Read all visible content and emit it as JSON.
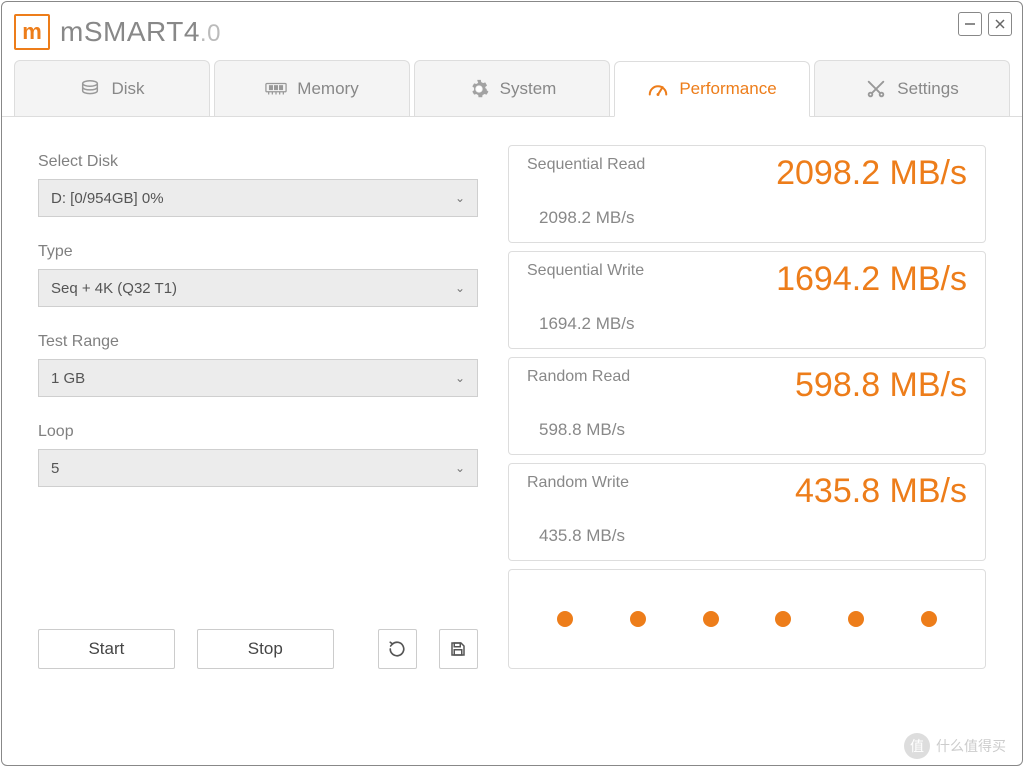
{
  "app": {
    "name": "mSMART",
    "version_major": "4",
    "version_minor": ".0"
  },
  "tabs": {
    "disk": "Disk",
    "memory": "Memory",
    "system": "System",
    "performance": "Performance",
    "settings": "Settings"
  },
  "form": {
    "select_disk_label": "Select Disk",
    "select_disk_value": "D: [0/954GB] 0%",
    "type_label": "Type",
    "type_value": "Seq + 4K (Q32 T1)",
    "range_label": "Test Range",
    "range_value": "1 GB",
    "loop_label": "Loop",
    "loop_value": "5"
  },
  "buttons": {
    "start": "Start",
    "stop": "Stop"
  },
  "results": {
    "seq_read": {
      "title": "Sequential Read",
      "big": "2098.2 MB/s",
      "small": "2098.2 MB/s"
    },
    "seq_write": {
      "title": "Sequential Write",
      "big": "1694.2 MB/s",
      "small": "1694.2 MB/s"
    },
    "rnd_read": {
      "title": "Random Read",
      "big": "598.8 MB/s",
      "small": "598.8 MB/s"
    },
    "rnd_write": {
      "title": "Random Write",
      "big": "435.8 MB/s",
      "small": "435.8 MB/s"
    }
  },
  "watermark": "什么值得买",
  "colors": {
    "accent": "#ed7d1a",
    "muted": "#888888"
  }
}
